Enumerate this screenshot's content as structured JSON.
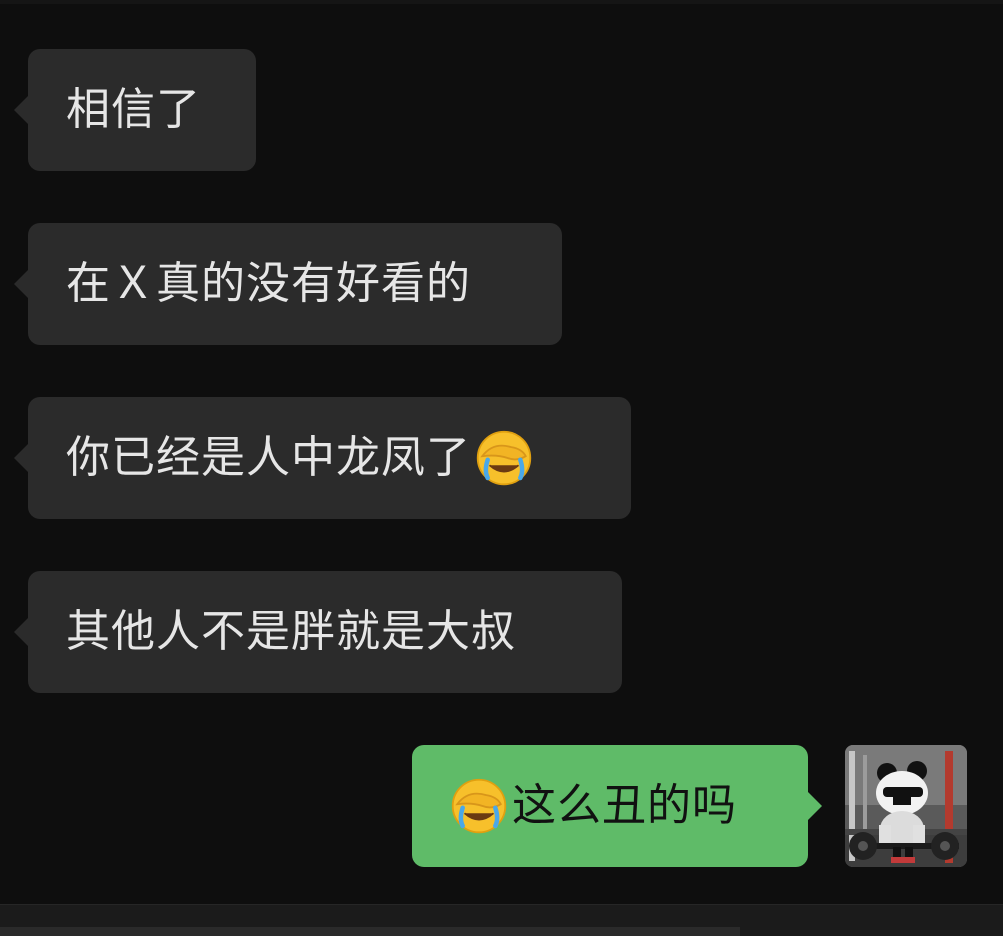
{
  "messages": [
    {
      "side": "in",
      "text": "相信了"
    },
    {
      "side": "in",
      "text": "在Ｘ真的没有好看的"
    },
    {
      "side": "in",
      "text": "你已经是人中龙凤了",
      "emoji_after": "face-palm-crying-icon"
    },
    {
      "side": "in",
      "text": "其他人不是胖就是大叔"
    },
    {
      "side": "out",
      "text": "这么丑的吗",
      "emoji_before": "face-palm-crying-icon"
    }
  ],
  "colors": {
    "background": "#0e0e0e",
    "incoming_bubble": "#2b2b2b",
    "incoming_text": "#e6e6e6",
    "outgoing_bubble": "#5fbb68",
    "outgoing_text": "#111111"
  },
  "avatar": {
    "icon": "panda-gym-avatar-icon"
  }
}
